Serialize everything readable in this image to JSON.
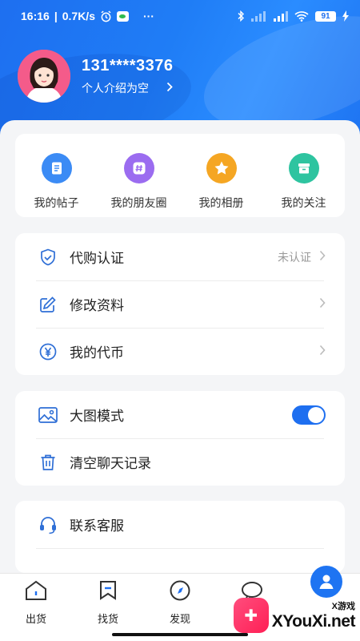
{
  "status_bar": {
    "time": "16:16",
    "network_speed": "0.7K/s",
    "more": "···",
    "battery": "91"
  },
  "profile": {
    "phone": "131****3376",
    "intro": "个人介绍为空"
  },
  "quick_grid": [
    {
      "label": "我的帖子",
      "icon": "posts-icon",
      "color": "#3b8bf5"
    },
    {
      "label": "我的朋友圈",
      "icon": "moments-icon",
      "color": "#9b6cf0"
    },
    {
      "label": "我的相册",
      "icon": "album-icon",
      "color": "#f5a623"
    },
    {
      "label": "我的关注",
      "icon": "follow-icon",
      "color": "#2ec4a0"
    }
  ],
  "account_list": [
    {
      "label": "代购认证",
      "icon": "shield-icon",
      "value": "未认证"
    },
    {
      "label": "修改资料",
      "icon": "edit-icon",
      "value": ""
    },
    {
      "label": "我的代币",
      "icon": "yuan-icon",
      "value": ""
    }
  ],
  "settings_list": [
    {
      "label": "大图模式",
      "icon": "image-icon",
      "toggle": true
    },
    {
      "label": "清空聊天记录",
      "icon": "trash-icon"
    }
  ],
  "support_list": [
    {
      "label": "联系客服",
      "icon": "headset-icon"
    }
  ],
  "tabs": [
    {
      "label": "出货",
      "icon": "house-icon"
    },
    {
      "label": "找货",
      "icon": "bookmark-icon"
    },
    {
      "label": "发现",
      "icon": "compass-icon"
    },
    {
      "label": "",
      "icon": "chat-icon"
    }
  ],
  "watermark": {
    "small": "X游戏",
    "big": "XYouXi.net"
  },
  "colors": {
    "primary": "#1e6ff0",
    "background": "#f4f5f7"
  }
}
